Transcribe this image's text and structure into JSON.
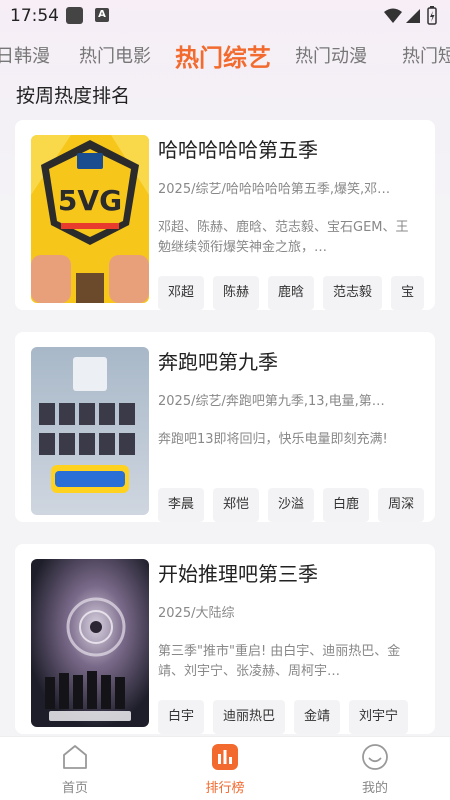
{
  "status_bar": {
    "time": "17:54",
    "notification_letter": "A"
  },
  "tabs": [
    {
      "label": "日韩漫"
    },
    {
      "label": "热门电影"
    },
    {
      "label": "热门综艺"
    },
    {
      "label": "热门动漫"
    },
    {
      "label": "热门短"
    }
  ],
  "active_tab": "热门综艺",
  "section_title": "按周热度排名",
  "shows": [
    {
      "title": "哈哈哈哈哈第五季",
      "meta": "2025/综艺/哈哈哈哈哈第五季,爆笑,邓…",
      "desc": "邓超、陈赫、鹿晗、范志毅、宝石GEM、王勉继续领衔爆笑神金之旅，…",
      "tags": [
        "邓超",
        "陈赫",
        "鹿晗",
        "范志毅",
        "宝"
      ]
    },
    {
      "title": "奔跑吧第九季",
      "meta": "2025/综艺/奔跑吧第九季,13,电量,第…",
      "desc": "奔跑吧13即将回归，快乐电量即刻充满!",
      "tags": [
        "李晨",
        "郑恺",
        "沙溢",
        "白鹿",
        "周深"
      ]
    },
    {
      "title": "开始推理吧第三季",
      "meta": "2025/大陆综",
      "desc": "第三季\"推市\"重启! 由白宇、迪丽热巴、金靖、刘宇宁、张凌赫、周柯宇…",
      "tags": [
        "白宇",
        "迪丽热巴",
        "金靖",
        "刘宇宁"
      ]
    }
  ],
  "bottom_nav": [
    {
      "label": "首页",
      "icon": "home-icon"
    },
    {
      "label": "排行榜",
      "icon": "ranking-icon"
    },
    {
      "label": "我的",
      "icon": "profile-icon"
    }
  ],
  "colors": {
    "accent": "#f26a2e",
    "background": "#f4f4f6"
  }
}
